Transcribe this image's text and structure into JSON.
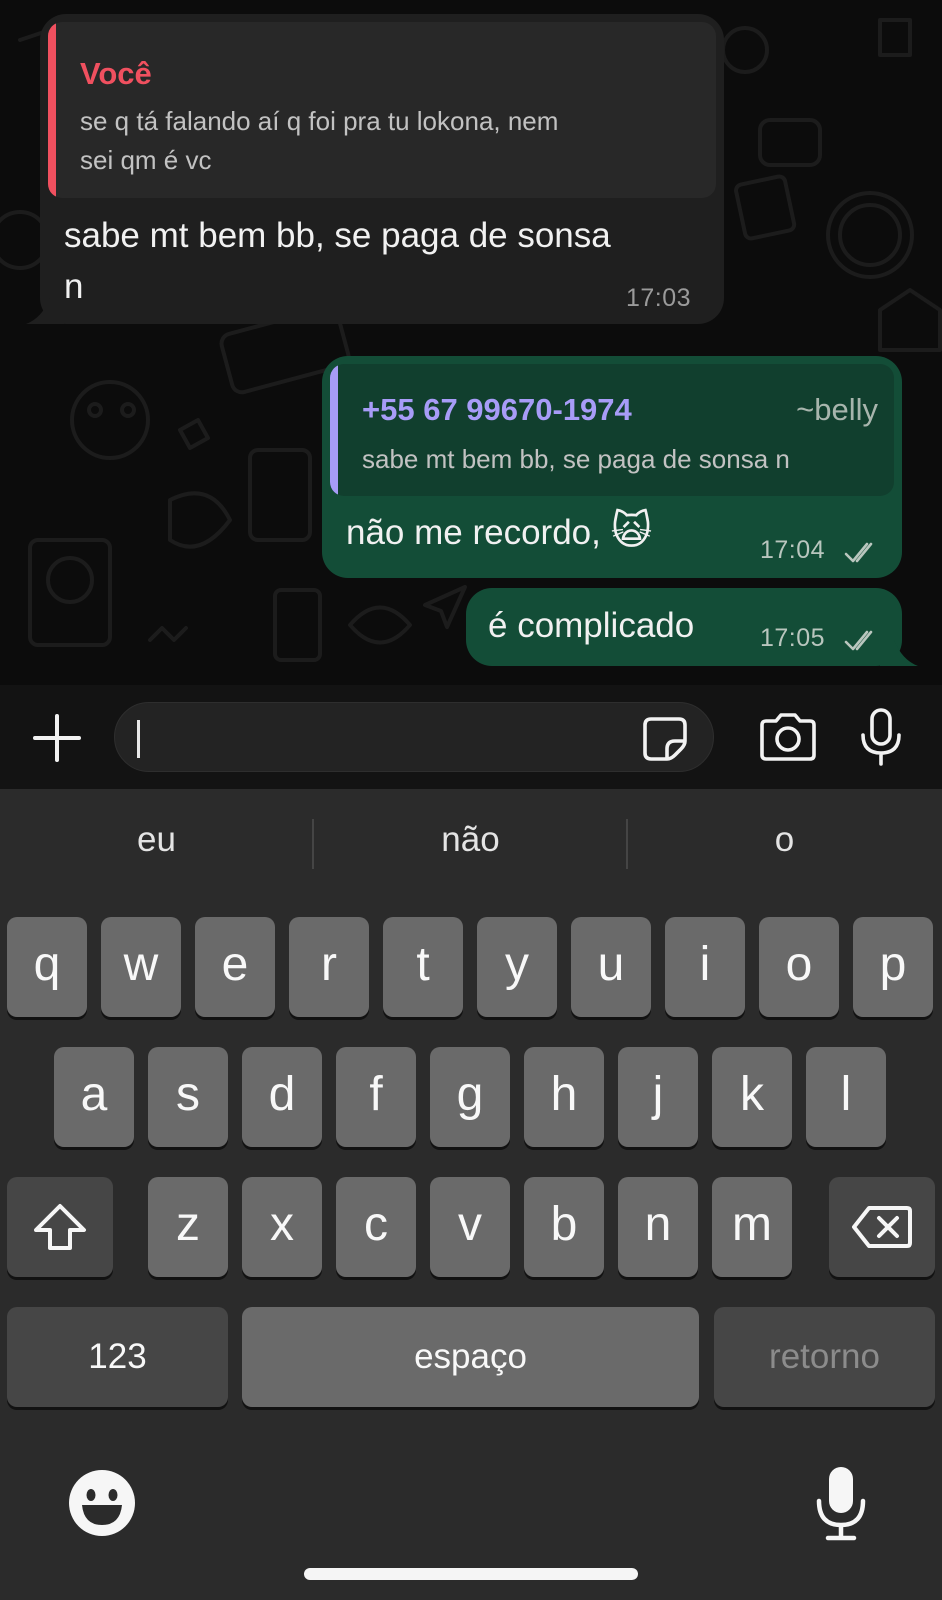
{
  "messages": [
    {
      "direction": "incoming",
      "quote_author": "Você",
      "quote_text_line1": "se q tá falando aí q foi pra tu lokona, nem",
      "quote_text_line2": "sei qm é vc",
      "text_line1": "sabe mt bem bb, se paga de sonsa",
      "text_line2": "n",
      "time": "17:03"
    },
    {
      "direction": "outgoing",
      "quote_author": "+55 67 99670-1974",
      "quote_alias": "~belly",
      "quote_text": "sabe mt bem bb, se paga de sonsa n",
      "text": "não me recordo,",
      "emoji": "🙀",
      "time": "17:04",
      "status": "read"
    },
    {
      "direction": "outgoing",
      "text": "é complicado",
      "time": "17:05",
      "status": "read"
    }
  ],
  "composer": {
    "value": "",
    "icons": [
      "plus-icon",
      "sticker-icon",
      "camera-icon",
      "microphone-icon"
    ]
  },
  "keyboard": {
    "suggestions": [
      "eu",
      "não",
      "o"
    ],
    "row1": [
      "q",
      "w",
      "e",
      "r",
      "t",
      "y",
      "u",
      "i",
      "o",
      "p"
    ],
    "row2": [
      "a",
      "s",
      "d",
      "f",
      "g",
      "h",
      "j",
      "k",
      "l"
    ],
    "row3": [
      "z",
      "x",
      "c",
      "v",
      "b",
      "n",
      "m"
    ],
    "numbers_label": "123",
    "space_label": "espaço",
    "return_label": "retorno",
    "icons": [
      "shift-icon",
      "backspace-icon",
      "emoji-icon",
      "dictation-icon"
    ]
  },
  "colors": {
    "incoming_bubble": "#1f1f1f",
    "outgoing_bubble": "#134d37",
    "quote_you": "#f0505f",
    "quote_other": "#a79cf7",
    "read_ticks": "#b9c6be"
  }
}
